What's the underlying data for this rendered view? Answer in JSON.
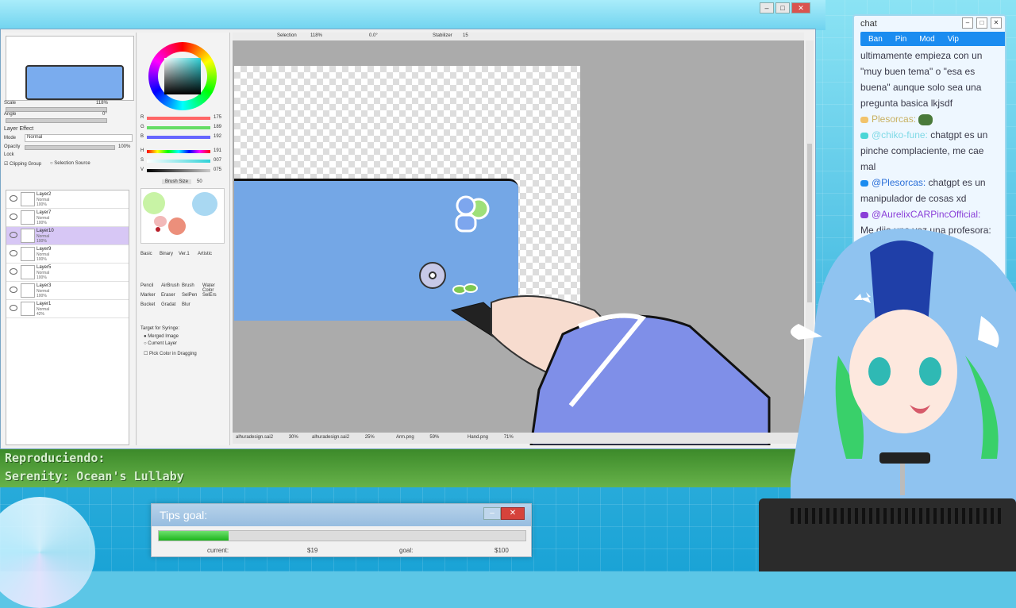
{
  "sai": {
    "toolbar": {
      "selection": "Selection",
      "zoom": "118%",
      "angle": "0.0°",
      "stabilizer": "Stabilizer",
      "stabilizer_val": "15"
    },
    "nav": {
      "scale_label": "Scale",
      "scale_val": "118%",
      "angle_label": "Angle",
      "angle_val": "0°"
    },
    "layer_effect": {
      "title": "Layer Effect",
      "mode_label": "Mode",
      "mode_val": "Normal",
      "opacity_label": "Opacity",
      "opacity_val": "100%",
      "lock_label": "Lock",
      "clipping": "Clipping Group",
      "selection_source": "Selection Source"
    },
    "layers": [
      {
        "name": "Layer2",
        "mode": "Normal",
        "opacity": "100%"
      },
      {
        "name": "Layer7",
        "mode": "Normal",
        "opacity": "100%"
      },
      {
        "name": "Layer10",
        "mode": "Normal",
        "opacity": "100%"
      },
      {
        "name": "Layer9",
        "mode": "Normal",
        "opacity": "100%"
      },
      {
        "name": "Layer5",
        "mode": "Normal",
        "opacity": "100%"
      },
      {
        "name": "Layer3",
        "mode": "Normal",
        "opacity": "100%"
      },
      {
        "name": "Layer1",
        "mode": "Normal",
        "opacity": "42%"
      }
    ],
    "color": {
      "r_label": "R",
      "r_val": "175",
      "g_label": "G",
      "g_val": "189",
      "b_label": "B",
      "b_val": "192",
      "h_label": "H",
      "h_val": "191",
      "s_label": "S",
      "s_val": "007",
      "v_label": "V",
      "v_val": "075"
    },
    "brush": {
      "size_label": "Brush Size",
      "size_val": "50"
    },
    "tool_tabs": [
      "Basic",
      "Binary",
      "Ver.1",
      "Artistic"
    ],
    "tools": [
      "Pencil",
      "AirBrush",
      "Brush",
      "Water Color",
      "Marker",
      "Eraser",
      "SelPen",
      "SelErs",
      "Bucket",
      "Gradat",
      "Blur"
    ],
    "syringe": {
      "title": "Target for Syringe:",
      "merged": "Merged Image",
      "current": "Current Layer",
      "pick": "Pick Color in Dragging"
    },
    "tabs": [
      {
        "name": "alhuradesign.sai2",
        "zoom": "30%"
      },
      {
        "name": "alhuradesign.sai2",
        "zoom": "25%"
      },
      {
        "name": "Arm.png",
        "zoom": "59%"
      },
      {
        "name": "Hand.png",
        "zoom": "71%"
      }
    ]
  },
  "chat": {
    "title": "chat",
    "mod_buttons": [
      "Ban",
      "Pin",
      "Mod",
      "Vip"
    ],
    "lines": [
      {
        "text": "ultimamente empieza con un \"muy buen tema\" o \"esa es buena\" aunque solo sea una pregunta basica lkjsdf"
      },
      {
        "user": "Plesorcas:",
        "text": ""
      },
      {
        "user": "@chiko-fune:",
        "text": " chatgpt es un pinche complaciente, me cae mal"
      },
      {
        "user": "@Plesorcas:",
        "text": " chatgpt es un manipulador de cosas xd"
      },
      {
        "user": "@AurelixCARPincOfficial:",
        "text": ""
      },
      {
        "text": "Me dijo una vez una profesora: ... ogo ... que"
      }
    ]
  },
  "now_playing": {
    "label": "Reproduciendo:",
    "track": "Serenity: Ocean's Lullaby"
  },
  "tips_goal": {
    "title": "Tips goal:",
    "current_label": "current:",
    "current_val": "$19",
    "goal_label": "goal:",
    "goal_val": "$100",
    "progress": 0.19
  },
  "colors": {
    "accent": "#1b8cf0",
    "canvas_blue": "#74a7e6",
    "sleeve": "#7f8fe8",
    "hair": "#8fc3f0",
    "hair_green": "#39d06a"
  }
}
